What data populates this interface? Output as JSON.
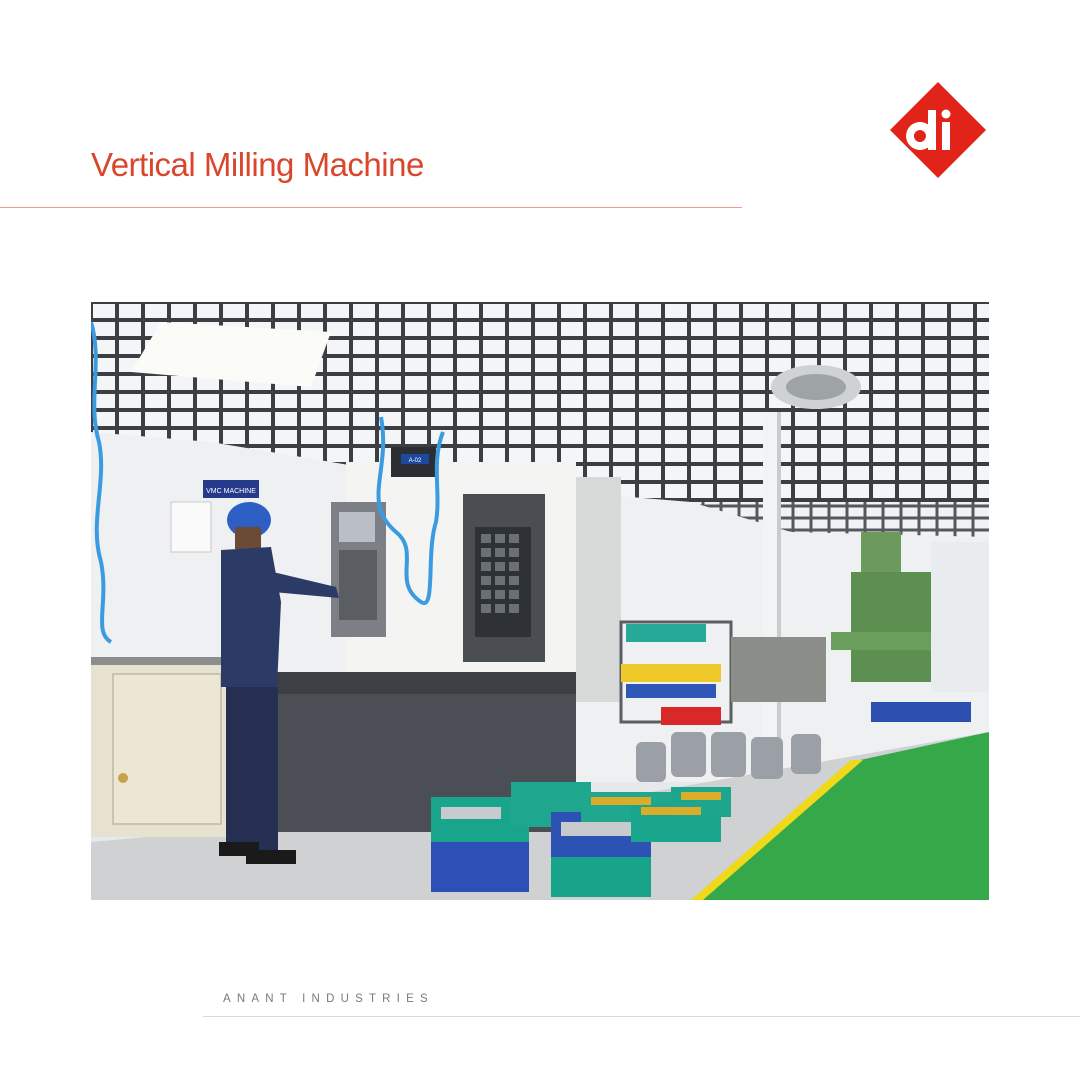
{
  "header": {
    "title": "Vertical Milling Machine"
  },
  "logo": {
    "icon": "diamond-logo-icon",
    "letters": "di",
    "color": "#e2231a"
  },
  "photo": {
    "subject": "factory-floor-photo",
    "sign_text": "VMC MACHINE",
    "machine_tag": "A-02"
  },
  "footer": {
    "company": "ANANT INDUSTRIES"
  },
  "colors": {
    "accent": "#d9462c",
    "rule": "#e9a08f",
    "text_muted": "#7a7a7a"
  }
}
